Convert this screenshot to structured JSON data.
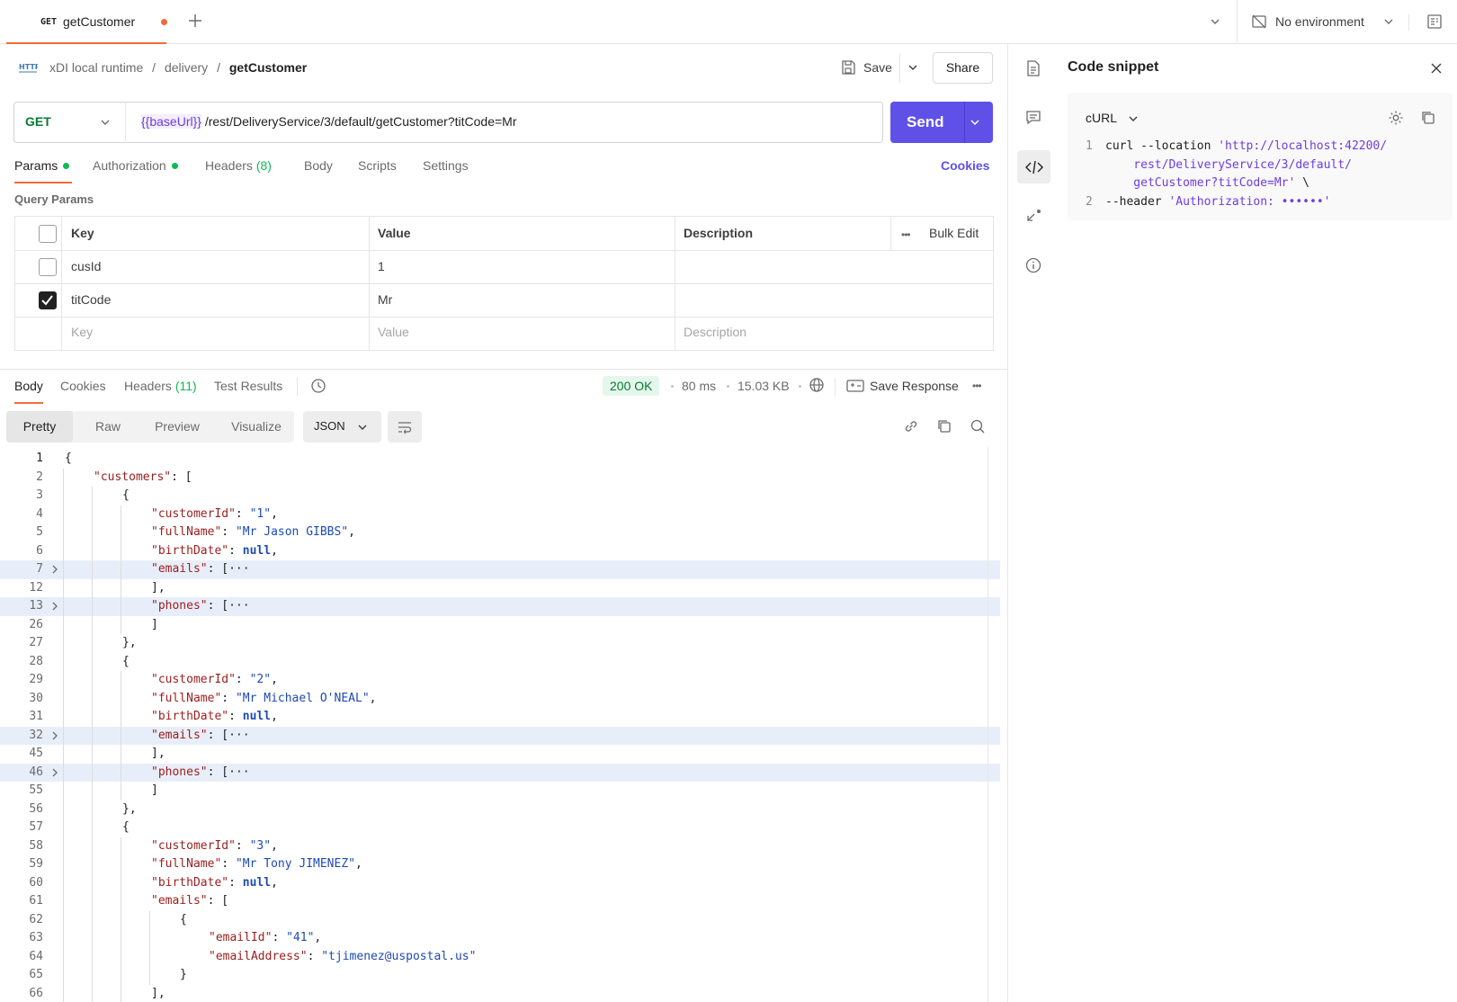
{
  "tab": {
    "method": "GET",
    "name": "getCustomer"
  },
  "environment": {
    "label": "No environment"
  },
  "breadcrumb": {
    "workspace": "xDI local runtime",
    "folder": "delivery",
    "request": "getCustomer",
    "sep": "/"
  },
  "header_actions": {
    "save_label": "Save",
    "share_label": "Share"
  },
  "request": {
    "method": "GET",
    "url_variable": "{{baseUrl}}",
    "url_path": "/rest/DeliveryService/3/default/getCustomer?titCode=Mr",
    "send_label": "Send"
  },
  "request_tabs": [
    {
      "label": "Params",
      "dot": true
    },
    {
      "label": "Authorization",
      "dot": true
    },
    {
      "label": "Headers",
      "count": "(8)"
    },
    {
      "label": "Body"
    },
    {
      "label": "Scripts"
    },
    {
      "label": "Settings"
    }
  ],
  "cookies_label": "Cookies",
  "query_params": {
    "title": "Query Params",
    "columns": {
      "key": "Key",
      "value": "Value",
      "description": "Description",
      "bulk_edit": "Bulk Edit"
    },
    "rows": [
      {
        "checked": false,
        "key": "cusId",
        "value": "1",
        "description": ""
      },
      {
        "checked": true,
        "key": "titCode",
        "value": "Mr",
        "description": ""
      }
    ],
    "placeholders": {
      "key": "Key",
      "value": "Value",
      "description": "Description"
    }
  },
  "response_tabs": [
    {
      "label": "Body"
    },
    {
      "label": "Cookies"
    },
    {
      "label": "Headers",
      "count": "(11)"
    },
    {
      "label": "Test Results"
    }
  ],
  "response_meta": {
    "status": "200 OK",
    "time": "80 ms",
    "size": "15.03 KB",
    "save_response": "Save Response"
  },
  "view_modes": [
    "Pretty",
    "Raw",
    "Preview",
    "Visualize"
  ],
  "format": "JSON",
  "code_lines": [
    {
      "n": "1",
      "indent": 0,
      "t": [
        [
          "p",
          "{"
        ]
      ]
    },
    {
      "n": "2",
      "indent": 1,
      "t": [
        [
          "k",
          "\"customers\""
        ],
        [
          "p",
          ": ["
        ]
      ]
    },
    {
      "n": "3",
      "indent": 2,
      "t": [
        [
          "p",
          "{"
        ]
      ]
    },
    {
      "n": "4",
      "indent": 3,
      "t": [
        [
          "k",
          "\"customerId\""
        ],
        [
          "p",
          ": "
        ],
        [
          "s",
          "\"1\""
        ],
        [
          "p",
          ","
        ]
      ]
    },
    {
      "n": "5",
      "indent": 3,
      "t": [
        [
          "k",
          "\"fullName\""
        ],
        [
          "p",
          ": "
        ],
        [
          "s",
          "\"Mr Jason GIBBS\""
        ],
        [
          "p",
          ","
        ]
      ]
    },
    {
      "n": "6",
      "indent": 3,
      "t": [
        [
          "k",
          "\"birthDate\""
        ],
        [
          "p",
          ": "
        ],
        [
          "n",
          "null"
        ],
        [
          "p",
          ","
        ]
      ]
    },
    {
      "n": "7",
      "indent": 3,
      "fold": true,
      "hl": true,
      "t": [
        [
          "k",
          "\"emails\""
        ],
        [
          "p",
          ": [···"
        ]
      ]
    },
    {
      "n": "12",
      "indent": 3,
      "t": [
        [
          "p",
          "],"
        ]
      ]
    },
    {
      "n": "13",
      "indent": 3,
      "fold": true,
      "hl": true,
      "t": [
        [
          "k",
          "\"phones\""
        ],
        [
          "p",
          ": [···"
        ]
      ]
    },
    {
      "n": "26",
      "indent": 3,
      "t": [
        [
          "p",
          "]"
        ]
      ]
    },
    {
      "n": "27",
      "indent": 2,
      "t": [
        [
          "p",
          "},"
        ]
      ]
    },
    {
      "n": "28",
      "indent": 2,
      "t": [
        [
          "p",
          "{"
        ]
      ]
    },
    {
      "n": "29",
      "indent": 3,
      "t": [
        [
          "k",
          "\"customerId\""
        ],
        [
          "p",
          ": "
        ],
        [
          "s",
          "\"2\""
        ],
        [
          "p",
          ","
        ]
      ]
    },
    {
      "n": "30",
      "indent": 3,
      "t": [
        [
          "k",
          "\"fullName\""
        ],
        [
          "p",
          ": "
        ],
        [
          "s",
          "\"Mr Michael O'NEAL\""
        ],
        [
          "p",
          ","
        ]
      ]
    },
    {
      "n": "31",
      "indent": 3,
      "t": [
        [
          "k",
          "\"birthDate\""
        ],
        [
          "p",
          ": "
        ],
        [
          "n",
          "null"
        ],
        [
          "p",
          ","
        ]
      ]
    },
    {
      "n": "32",
      "indent": 3,
      "fold": true,
      "hl": true,
      "t": [
        [
          "k",
          "\"emails\""
        ],
        [
          "p",
          ": [···"
        ]
      ]
    },
    {
      "n": "45",
      "indent": 3,
      "t": [
        [
          "p",
          "],"
        ]
      ]
    },
    {
      "n": "46",
      "indent": 3,
      "fold": true,
      "hl": true,
      "t": [
        [
          "k",
          "\"phones\""
        ],
        [
          "p",
          ": [···"
        ]
      ]
    },
    {
      "n": "55",
      "indent": 3,
      "t": [
        [
          "p",
          "]"
        ]
      ]
    },
    {
      "n": "56",
      "indent": 2,
      "t": [
        [
          "p",
          "},"
        ]
      ]
    },
    {
      "n": "57",
      "indent": 2,
      "t": [
        [
          "p",
          "{"
        ]
      ]
    },
    {
      "n": "58",
      "indent": 3,
      "t": [
        [
          "k",
          "\"customerId\""
        ],
        [
          "p",
          ": "
        ],
        [
          "s",
          "\"3\""
        ],
        [
          "p",
          ","
        ]
      ]
    },
    {
      "n": "59",
      "indent": 3,
      "t": [
        [
          "k",
          "\"fullName\""
        ],
        [
          "p",
          ": "
        ],
        [
          "s",
          "\"Mr Tony JIMENEZ\""
        ],
        [
          "p",
          ","
        ]
      ]
    },
    {
      "n": "60",
      "indent": 3,
      "t": [
        [
          "k",
          "\"birthDate\""
        ],
        [
          "p",
          ": "
        ],
        [
          "n",
          "null"
        ],
        [
          "p",
          ","
        ]
      ]
    },
    {
      "n": "61",
      "indent": 3,
      "t": [
        [
          "k",
          "\"emails\""
        ],
        [
          "p",
          ": ["
        ]
      ]
    },
    {
      "n": "62",
      "indent": 4,
      "t": [
        [
          "p",
          "{"
        ]
      ]
    },
    {
      "n": "63",
      "indent": 5,
      "t": [
        [
          "k",
          "\"emailId\""
        ],
        [
          "p",
          ": "
        ],
        [
          "s",
          "\"41\""
        ],
        [
          "p",
          ","
        ]
      ]
    },
    {
      "n": "64",
      "indent": 5,
      "t": [
        [
          "k",
          "\"emailAddress\""
        ],
        [
          "p",
          ": "
        ],
        [
          "s",
          "\"tjimenez@uspostal.us\""
        ]
      ]
    },
    {
      "n": "65",
      "indent": 4,
      "t": [
        [
          "p",
          "}"
        ]
      ]
    },
    {
      "n": "66",
      "indent": 3,
      "t": [
        [
          "p",
          "],"
        ]
      ]
    }
  ],
  "code_snippet": {
    "title": "Code snippet",
    "language": "cURL",
    "lines": [
      {
        "n": "1",
        "t": [
          [
            "p",
            "curl --location "
          ],
          [
            "str",
            "'http://localhost:42200/"
          ]
        ]
      },
      {
        "n": "",
        "t": [
          [
            "str",
            "    rest/DeliveryService/3/default/"
          ]
        ]
      },
      {
        "n": "",
        "t": [
          [
            "str",
            "    getCustomer?titCode=Mr'"
          ],
          [
            "p",
            " \\"
          ]
        ]
      },
      {
        "n": "2",
        "t": [
          [
            "p",
            "--header "
          ],
          [
            "str",
            "'Authorization: ••••••'"
          ]
        ]
      }
    ]
  },
  "colors": {
    "accent": "#5f51e8",
    "tab_indicator": "#f26b3a",
    "ok": "#0cbb52"
  }
}
